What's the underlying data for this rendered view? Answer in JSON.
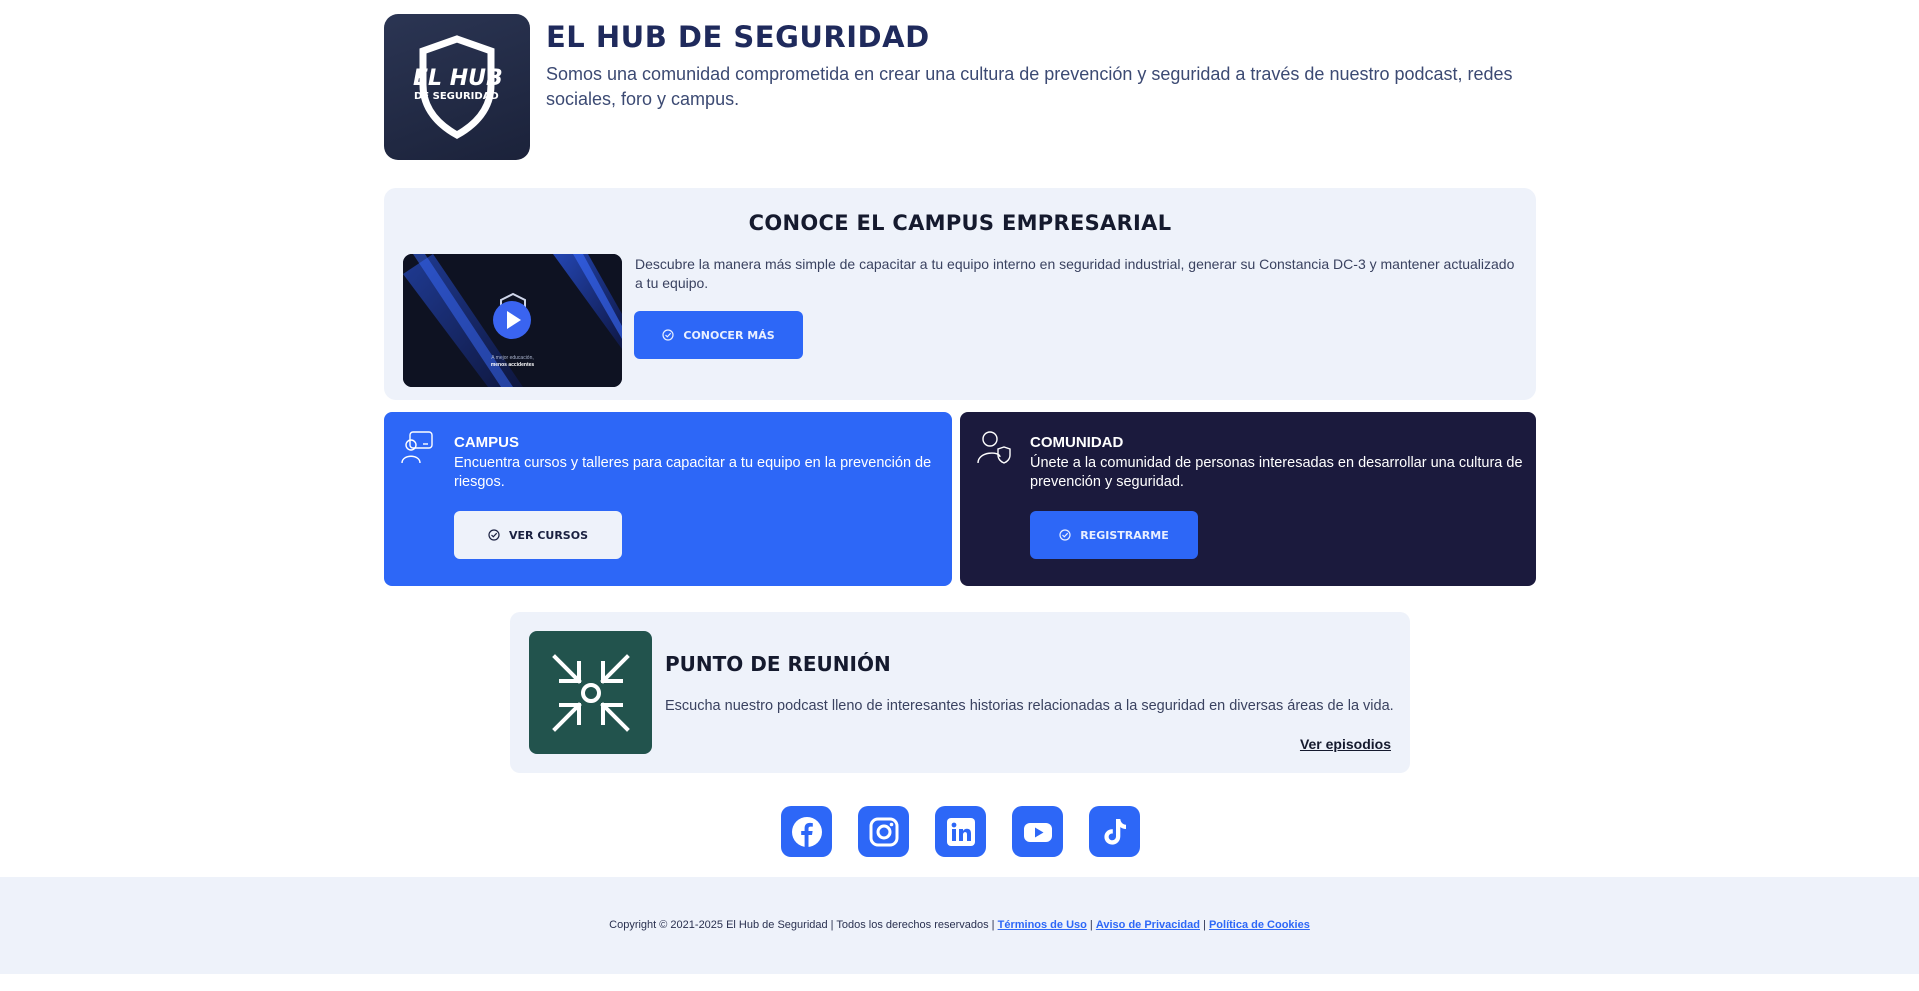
{
  "header": {
    "logo_alt": "El Hub de Seguridad logo",
    "title": "EL HUB DE SEGURIDAD",
    "description": "Somos una comunidad comprometida en crear una cultura de prevención y seguridad a través de nuestro podcast, redes sociales, foro y campus."
  },
  "campus_empresarial": {
    "title": "CONOCE EL CAMPUS EMPRESARIAL",
    "description": "Descubre la manera más simple de capacitar a tu equipo interno en seguridad industrial, generar su Constancia DC-3 y mantener actualizado a tu equipo.",
    "button_label": "CONOCER MÁS",
    "video_caption_1": "A mejor educación,",
    "video_caption_2": "menos accidentes"
  },
  "campus": {
    "title": "CAMPUS",
    "description": "Encuentra cursos y talleres para capacitar a tu equipo en la prevención de riesgos.",
    "button_label": "VER CURSOS"
  },
  "comunidad": {
    "title": "COMUNIDAD",
    "description": "Únete a la comunidad de personas interesadas en desarrollar una cultura de prevención y seguridad.",
    "button_label": "REGISTRARME"
  },
  "podcast": {
    "title": "PUNTO DE REUNIÓN",
    "description": "Escucha nuestro podcast lleno de interesantes historias relacionadas a la seguridad en diversas áreas de la vida.",
    "link_label": "Ver episodios"
  },
  "socials": [
    "facebook-icon",
    "instagram-icon",
    "linkedin-icon",
    "youtube-icon",
    "tiktok-icon"
  ],
  "footer": {
    "copyright": "Copyright © 2021-2025 El Hub de Seguridad | Todos los derechos reservados |",
    "terms": "Términos de Uso",
    "privacy": "Aviso de Privacidad",
    "cookies": "Política de Cookies",
    "separator": "|"
  },
  "colors": {
    "primary_blue": "#2d67f7",
    "dark_navy": "#1b1a3d",
    "podcast_green": "#22534d",
    "card_bg": "#eef2fa"
  }
}
